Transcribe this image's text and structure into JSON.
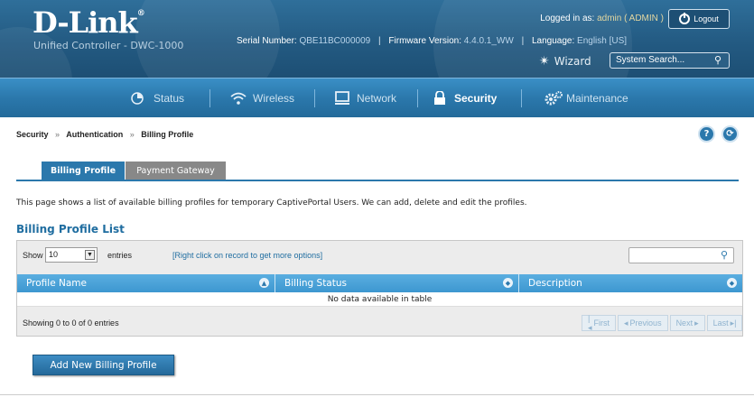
{
  "header": {
    "brand": "D-Link",
    "brand_reg": "®",
    "subtitle": "Unified Controller - DWC-1000",
    "logged_in_label": "Logged in as:",
    "logged_in_value": "admin ( ADMIN )",
    "logout_label": "Logout",
    "serial_label": "Serial Number:",
    "serial_value": "QBE11BC000009",
    "firmware_label": "Firmware Version:",
    "firmware_value": "4.4.0.1_WW",
    "language_label": "Language:",
    "language_value": "English [US]",
    "wizard_label": "Wizard",
    "search_placeholder": "System Search..."
  },
  "nav": {
    "items": [
      {
        "label": "Status",
        "icon": "status-icon"
      },
      {
        "label": "Wireless",
        "icon": "wifi-icon"
      },
      {
        "label": "Network",
        "icon": "network-icon"
      },
      {
        "label": "Security",
        "icon": "lock-icon",
        "active": true
      },
      {
        "label": "Maintenance",
        "icon": "gears-icon"
      }
    ]
  },
  "breadcrumb": {
    "items": [
      "Security",
      "Authentication",
      "Billing Profile"
    ],
    "separator": "»"
  },
  "tabs": [
    {
      "label": "Billing Profile",
      "active": true
    },
    {
      "label": "Payment Gateway",
      "active": false
    }
  ],
  "main": {
    "description": "This page shows a list of available billing profiles for temporary CaptivePortal Users. We can add, delete and edit the profiles.",
    "list_title": "Billing Profile List",
    "show_label": "Show",
    "show_value": "10",
    "entries_label": "entries",
    "hint": "[Right click on record to get more options]",
    "columns": [
      "Profile Name",
      "Billing Status",
      "Description"
    ],
    "empty_message": "No data available in table",
    "showing": "Showing 0 to 0 of 0 entries",
    "pager": {
      "first": "First",
      "previous": "Previous",
      "next": "Next",
      "last": "Last"
    },
    "add_button": "Add New Billing Profile"
  },
  "colors": {
    "header_bg": "#235a82",
    "nav_bg": "#2b78ac",
    "accent": "#1f6da0",
    "table_header": "#3d97d0"
  }
}
